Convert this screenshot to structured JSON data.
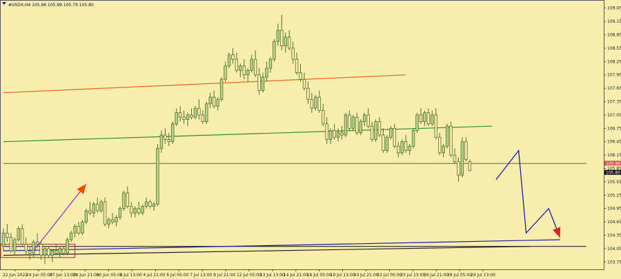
{
  "chart_data": {
    "type": "candlestick",
    "title": "#USDX,H4  105.96 105.99 105.79 105.80",
    "symbol": "#USDX",
    "timeframe": "H4",
    "ohlc_header": {
      "open": 105.96,
      "high": 105.99,
      "low": 105.79,
      "close": 105.8
    },
    "price_tag_red": "105.96",
    "price_tag_current": "105.80",
    "ylim": [
      103.6,
      109.6
    ],
    "y_ticks": [
      "109.45",
      "109.15",
      "108.85",
      "108.55",
      "108.25",
      "107.95",
      "107.65",
      "107.35",
      "107.05",
      "106.75",
      "106.45",
      "106.15",
      "105.85",
      "105.55",
      "105.25",
      "104.95",
      "104.65",
      "104.35",
      "104.05",
      "103.75"
    ],
    "x_ticks": [
      "22 Jun 2022",
      "24 Jun 05:00",
      "27 Jun 13:00",
      "28 Jun 21:00",
      "30 Jun 05:00",
      "1 Jul 13:00",
      "4 Jul 21:00",
      "6 Jul 05:00",
      "7 Jul 13:00",
      "8 Jul 21:00",
      "12 Jul 05:00",
      "13 Jul 13:00",
      "14 Jul 21:00",
      "18 Jul 05:00",
      "19 Jul 13:00",
      "20 Jul 21:00",
      "22 Jul 05:00",
      "25 Jul 13:00",
      "26 Jul 21:00",
      "28 Jul 05:00",
      "29 Jul 13:00"
    ],
    "candles": [
      [
        104.1,
        104.5,
        104.0,
        104.4
      ],
      [
        104.4,
        104.6,
        104.2,
        104.3
      ],
      [
        104.3,
        104.4,
        103.95,
        104.0
      ],
      [
        104.0,
        104.3,
        103.9,
        104.25
      ],
      [
        104.25,
        104.55,
        104.2,
        104.5
      ],
      [
        104.5,
        104.6,
        104.1,
        104.15
      ],
      [
        104.15,
        104.3,
        103.9,
        104.0
      ],
      [
        104.0,
        104.1,
        103.8,
        103.95
      ],
      [
        103.95,
        104.25,
        103.85,
        104.2
      ],
      [
        104.2,
        104.4,
        104.1,
        104.15
      ],
      [
        104.15,
        104.2,
        103.8,
        103.9
      ],
      [
        103.9,
        104.1,
        103.7,
        104.05
      ],
      [
        104.05,
        104.1,
        103.85,
        103.9
      ],
      [
        103.9,
        104.05,
        103.75,
        104.0
      ],
      [
        104.0,
        104.15,
        103.9,
        103.95
      ],
      [
        103.95,
        104.1,
        103.85,
        104.05
      ],
      [
        104.05,
        104.1,
        103.9,
        103.95
      ],
      [
        103.95,
        104.3,
        103.9,
        104.25
      ],
      [
        104.25,
        104.45,
        104.2,
        104.4
      ],
      [
        104.4,
        104.6,
        104.3,
        104.55
      ],
      [
        104.55,
        104.65,
        104.35,
        104.4
      ],
      [
        104.4,
        104.7,
        104.35,
        104.65
      ],
      [
        104.65,
        104.95,
        104.6,
        104.9
      ],
      [
        104.9,
        105.1,
        104.8,
        104.85
      ],
      [
        104.85,
        105.1,
        104.75,
        105.05
      ],
      [
        105.05,
        105.2,
        104.85,
        104.9
      ],
      [
        104.9,
        105.15,
        104.85,
        105.1
      ],
      [
        105.1,
        105.2,
        104.55,
        104.6
      ],
      [
        104.6,
        104.75,
        104.5,
        104.7
      ],
      [
        104.7,
        104.85,
        104.6,
        104.65
      ],
      [
        104.65,
        104.8,
        104.55,
        104.75
      ],
      [
        104.75,
        105.0,
        104.7,
        104.95
      ],
      [
        104.95,
        105.35,
        104.9,
        105.3
      ],
      [
        105.3,
        105.45,
        104.95,
        105.0
      ],
      [
        105.0,
        105.1,
        104.75,
        104.85
      ],
      [
        104.85,
        105.0,
        104.75,
        104.95
      ],
      [
        104.95,
        105.1,
        104.8,
        104.85
      ],
      [
        104.85,
        105.05,
        104.8,
        105.0
      ],
      [
        105.0,
        105.2,
        104.95,
        105.1
      ],
      [
        105.1,
        105.15,
        104.95,
        105.0
      ],
      [
        105.0,
        105.1,
        104.9,
        105.05
      ],
      [
        105.05,
        106.4,
        105.0,
        106.3
      ],
      [
        106.3,
        106.7,
        106.2,
        106.6
      ],
      [
        106.6,
        106.75,
        106.4,
        106.5
      ],
      [
        106.5,
        106.65,
        106.35,
        106.45
      ],
      [
        106.45,
        106.9,
        106.4,
        106.85
      ],
      [
        106.85,
        107.2,
        106.8,
        107.1
      ],
      [
        107.1,
        107.25,
        106.9,
        107.0
      ],
      [
        107.0,
        107.15,
        106.85,
        106.95
      ],
      [
        106.95,
        107.1,
        106.8,
        107.05
      ],
      [
        107.05,
        107.2,
        106.95,
        107.0
      ],
      [
        107.0,
        107.25,
        106.95,
        107.2
      ],
      [
        107.2,
        107.4,
        106.95,
        107.05
      ],
      [
        107.05,
        107.15,
        106.85,
        106.9
      ],
      [
        106.9,
        107.35,
        106.85,
        107.3
      ],
      [
        107.3,
        107.55,
        107.2,
        107.45
      ],
      [
        107.45,
        107.6,
        107.2,
        107.25
      ],
      [
        107.25,
        107.45,
        107.15,
        107.4
      ],
      [
        107.4,
        107.9,
        107.35,
        107.85
      ],
      [
        107.85,
        108.25,
        107.8,
        108.15
      ],
      [
        108.15,
        108.45,
        108.1,
        108.4
      ],
      [
        108.4,
        108.55,
        108.2,
        108.3
      ],
      [
        108.3,
        108.45,
        108.0,
        108.05
      ],
      [
        108.05,
        108.2,
        107.9,
        108.15
      ],
      [
        108.15,
        108.3,
        107.85,
        107.95
      ],
      [
        107.95,
        108.1,
        107.8,
        108.05
      ],
      [
        108.05,
        108.4,
        108.0,
        108.3
      ],
      [
        108.3,
        108.5,
        107.9,
        107.95
      ],
      [
        107.95,
        108.1,
        107.5,
        107.6
      ],
      [
        107.6,
        108.0,
        107.55,
        107.9
      ],
      [
        107.9,
        108.25,
        107.8,
        108.1
      ],
      [
        108.1,
        108.35,
        108.0,
        108.3
      ],
      [
        108.3,
        108.75,
        108.25,
        108.7
      ],
      [
        108.7,
        109.1,
        108.6,
        108.95
      ],
      [
        108.95,
        109.3,
        108.5,
        108.6
      ],
      [
        108.6,
        108.9,
        108.45,
        108.8
      ],
      [
        108.8,
        108.95,
        108.5,
        108.55
      ],
      [
        108.55,
        108.7,
        108.2,
        108.3
      ],
      [
        108.3,
        108.45,
        107.95,
        108.0
      ],
      [
        108.0,
        108.2,
        107.8,
        107.85
      ],
      [
        107.85,
        108.0,
        107.6,
        107.65
      ],
      [
        107.65,
        107.8,
        107.3,
        107.4
      ],
      [
        107.4,
        107.55,
        107.1,
        107.2
      ],
      [
        107.2,
        107.5,
        107.15,
        107.45
      ],
      [
        107.45,
        107.6,
        107.1,
        107.15
      ],
      [
        107.15,
        107.3,
        106.8,
        106.85
      ],
      [
        106.85,
        107.0,
        106.4,
        106.5
      ],
      [
        106.5,
        106.75,
        106.4,
        106.7
      ],
      [
        106.7,
        106.85,
        106.5,
        106.55
      ],
      [
        106.55,
        106.75,
        106.45,
        106.65
      ],
      [
        106.65,
        106.8,
        106.5,
        106.6
      ],
      [
        106.6,
        107.1,
        106.55,
        107.05
      ],
      [
        107.05,
        107.15,
        106.7,
        106.75
      ],
      [
        106.75,
        107.05,
        106.7,
        107.0
      ],
      [
        107.0,
        107.1,
        106.6,
        106.65
      ],
      [
        106.65,
        106.95,
        106.6,
        106.9
      ],
      [
        106.9,
        107.1,
        106.8,
        107.05
      ],
      [
        107.05,
        107.2,
        106.75,
        106.8
      ],
      [
        106.8,
        106.9,
        106.45,
        106.5
      ],
      [
        106.5,
        106.95,
        106.45,
        106.9
      ],
      [
        106.9,
        107.0,
        106.55,
        106.6
      ],
      [
        106.6,
        106.75,
        106.2,
        106.25
      ],
      [
        106.25,
        106.6,
        106.2,
        106.55
      ],
      [
        106.55,
        106.8,
        106.5,
        106.75
      ],
      [
        106.75,
        106.85,
        106.3,
        106.35
      ],
      [
        106.35,
        106.45,
        106.1,
        106.2
      ],
      [
        106.2,
        106.5,
        106.15,
        106.45
      ],
      [
        106.45,
        106.6,
        106.2,
        106.25
      ],
      [
        106.25,
        106.4,
        106.15,
        106.35
      ],
      [
        106.35,
        106.75,
        106.3,
        106.7
      ],
      [
        106.7,
        107.1,
        106.65,
        107.05
      ],
      [
        107.05,
        107.2,
        106.85,
        106.9
      ],
      [
        106.9,
        107.15,
        106.8,
        107.1
      ],
      [
        107.1,
        107.2,
        106.8,
        106.85
      ],
      [
        106.85,
        107.15,
        106.8,
        107.05
      ],
      [
        107.05,
        107.2,
        106.5,
        106.55
      ],
      [
        106.55,
        106.65,
        106.15,
        106.2
      ],
      [
        106.2,
        106.4,
        106.1,
        106.35
      ],
      [
        106.35,
        106.85,
        106.3,
        106.8
      ],
      [
        106.8,
        106.9,
        106.1,
        106.15
      ],
      [
        106.15,
        106.3,
        105.95,
        106.0
      ],
      [
        106.0,
        106.1,
        105.55,
        105.7
      ],
      [
        105.7,
        106.55,
        105.65,
        106.45
      ],
      [
        106.45,
        106.55,
        106.0,
        106.05
      ],
      [
        106.0,
        106.05,
        105.79,
        105.8
      ]
    ],
    "lines": [
      {
        "name": "orange",
        "color": "#f06020",
        "from": [
          0,
          107.55
        ],
        "to": [
          107,
          107.95
        ]
      },
      {
        "name": "green",
        "color": "#2e8b2e",
        "from": [
          0,
          106.45
        ],
        "to": [
          130,
          106.8
        ]
      },
      {
        "name": "red-horizontal",
        "color": "#e05050",
        "from": [
          0,
          105.96
        ],
        "to": [
          155,
          105.96
        ]
      },
      {
        "name": "black-horizontal",
        "color": "#222222",
        "from": [
          0,
          104.1
        ],
        "to": [
          155,
          104.1
        ]
      },
      {
        "name": "blue-channel",
        "color": "#1a1aa8",
        "from": [
          0,
          104.0
        ],
        "to": [
          148,
          104.25
        ]
      },
      {
        "name": "dark-channel",
        "color": "#222222",
        "from": [
          0,
          103.9
        ],
        "to": [
          140,
          104.1
        ]
      }
    ],
    "arrows": [
      {
        "name": "purple-arrow",
        "color": "#9b30d0",
        "points": [
          [
            8,
            104.0
          ],
          [
            22,
            105.5
          ]
        ],
        "head": "#ff4500"
      },
      {
        "name": "forecast-path",
        "color": "#1a1aa8",
        "points": [
          [
            131,
            105.6
          ],
          [
            137,
            106.25
          ],
          [
            139,
            104.4
          ],
          [
            145,
            104.95
          ],
          [
            148,
            104.3
          ]
        ],
        "head": "#e02020"
      }
    ],
    "grid": false,
    "bull_color": "#b8d68a",
    "bear_color": "#f7eeae",
    "candle_outline": "#556b2f"
  }
}
